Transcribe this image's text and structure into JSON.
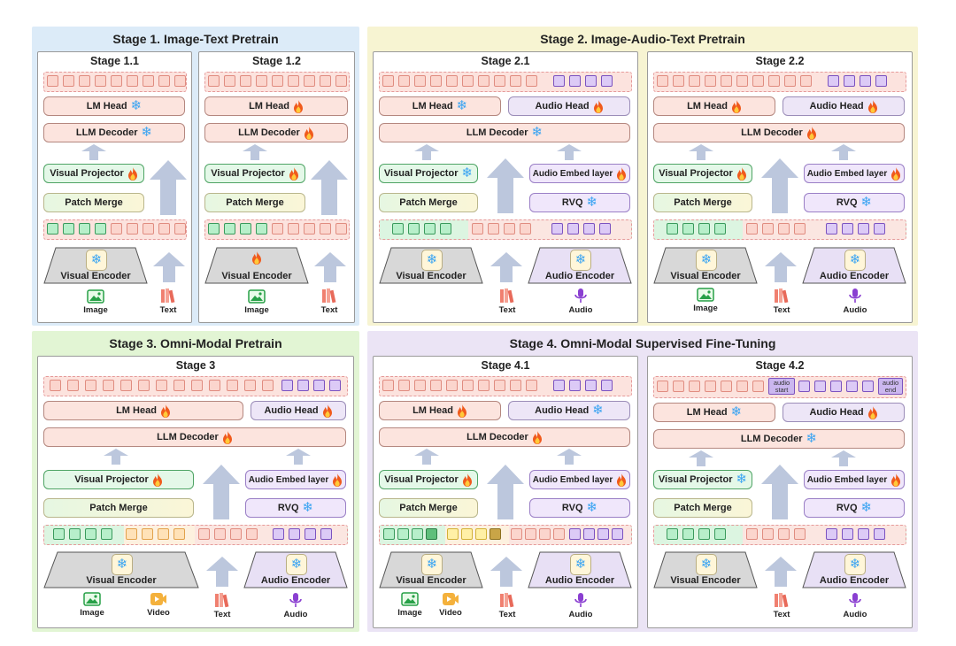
{
  "stage1": {
    "title": "Stage 1. Image-Text Pretrain",
    "p11": {
      "title": "Stage 1.1",
      "lm_head": "LM Head",
      "llm_decoder": "LLM Decoder",
      "visual_projector": "Visual Projector",
      "patch_merge": "Patch Merge",
      "visual_encoder": "Visual Encoder",
      "image": "Image",
      "text": "Text"
    },
    "p12": {
      "title": "Stage 1.2",
      "lm_head": "LM Head",
      "llm_decoder": "LLM Decoder",
      "visual_projector": "Visual Projector",
      "patch_merge": "Patch Merge",
      "visual_encoder": "Visual Encoder",
      "image": "Image",
      "text": "Text"
    }
  },
  "stage2": {
    "title": "Stage 2. Image-Audio-Text Pretrain",
    "p21": {
      "title": "Stage 2.1",
      "lm_head": "LM Head",
      "audio_head": "Audio Head",
      "llm_decoder": "LLM Decoder",
      "visual_projector": "Visual Projector",
      "audio_embed": "Audio Embed layer",
      "patch_merge": "Patch Merge",
      "rvq": "RVQ",
      "visual_encoder": "Visual Encoder",
      "audio_encoder": "Audio Encoder",
      "text": "Text",
      "audio": "Audio"
    },
    "p22": {
      "title": "Stage 2.2",
      "lm_head": "LM Head",
      "audio_head": "Audio Head",
      "llm_decoder": "LLM Decoder",
      "visual_projector": "Visual Projector",
      "audio_embed": "Audio Embed layer",
      "patch_merge": "Patch Merge",
      "rvq": "RVQ",
      "visual_encoder": "Visual Encoder",
      "audio_encoder": "Audio Encoder",
      "image": "Image",
      "text": "Text",
      "audio": "Audio"
    }
  },
  "stage3": {
    "title": "Stage 3. Omni-Modal Pretrain",
    "p3": {
      "title": "Stage 3",
      "lm_head": "LM Head",
      "audio_head": "Audio Head",
      "llm_decoder": "LLM Decoder",
      "visual_projector": "Visual Projector",
      "audio_embed": "Audio Embed layer",
      "patch_merge": "Patch Merge",
      "rvq": "RVQ",
      "visual_encoder": "Visual Encoder",
      "audio_encoder": "Audio Encoder",
      "image": "Image",
      "video": "Video",
      "text": "Text",
      "audio": "Audio"
    }
  },
  "stage4": {
    "title": "Stage 4. Omni-Modal Supervised Fine-Tuning",
    "p41": {
      "title": "Stage 4.1",
      "lm_head": "LM Head",
      "audio_head": "Audio Head",
      "llm_decoder": "LLM Decoder",
      "visual_projector": "Visual Projector",
      "audio_embed": "Audio Embed layer",
      "patch_merge": "Patch Merge",
      "rvq": "RVQ",
      "visual_encoder": "Visual Encoder",
      "audio_encoder": "Audio Encoder",
      "image": "Image",
      "video": "Video",
      "text": "Text",
      "audio": "Audio"
    },
    "p42": {
      "title": "Stage 4.2",
      "lm_head": "LM Head",
      "audio_head": "Audio Head",
      "llm_decoder": "LLM Decoder",
      "visual_projector": "Visual Projector",
      "audio_embed": "Audio Embed layer",
      "patch_merge": "Patch Merge",
      "rvq": "RVQ",
      "visual_encoder": "Visual Encoder",
      "audio_encoder": "Audio Encoder",
      "audio_start": "audio start",
      "audio_end": "audio end",
      "text": "Text",
      "audio": "Audio"
    }
  },
  "legend_icons": {
    "frozen": "snowflake-icon",
    "trainable": "fire-icon"
  },
  "colors": {
    "stage1_bg": "#dcebf8",
    "stage2_bg": "#f7f4d2",
    "stage3_bg": "#e2f5d4",
    "stage4_bg": "#ebe4f5",
    "text_token": "#fbd5cd",
    "image_token": "#b7efca",
    "audio_token": "#dccaf6",
    "video_token": "#ffe2b8"
  }
}
